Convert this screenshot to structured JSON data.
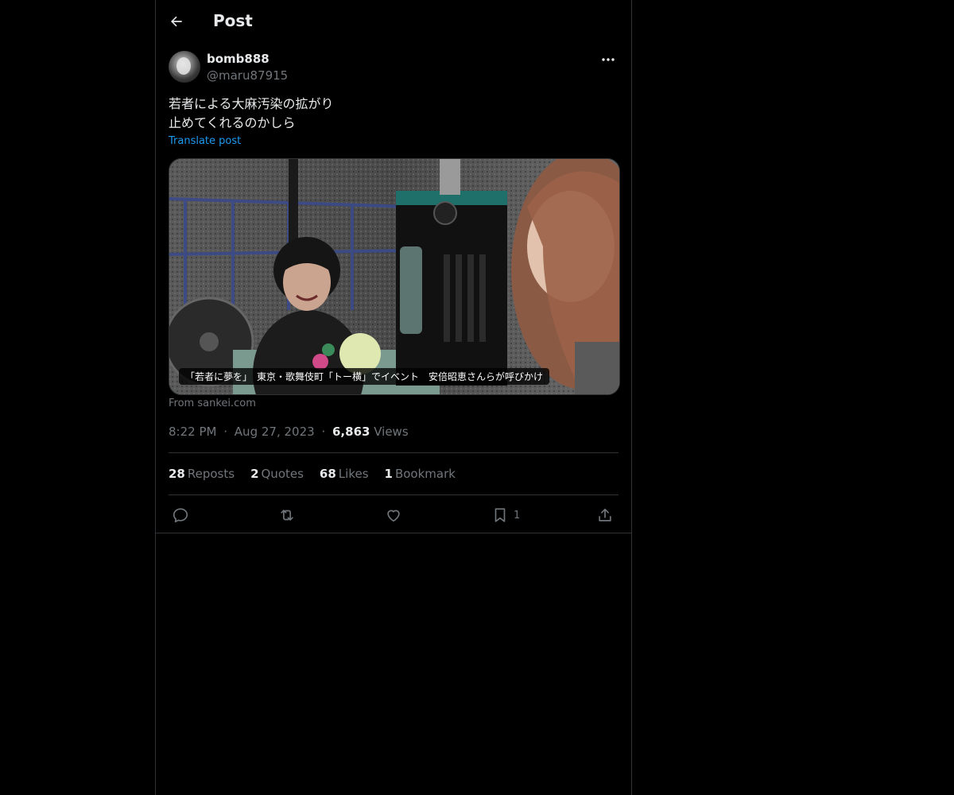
{
  "header": {
    "title": "Post",
    "back_icon": "arrow-left-icon"
  },
  "author": {
    "display_name": "bomb888",
    "handle": "@maru87915",
    "avatar_icon": "user-avatar"
  },
  "post": {
    "text_lines": [
      "若者による大麻汚染の拡がり",
      "止めてくれるのかしら"
    ],
    "translate_label": "Translate post"
  },
  "media": {
    "caption": "「若者に夢を」　東京・歌舞伎町「トー横」でイベント　安倍昭恵さんらが呼びかけ",
    "source": "From sankei.com"
  },
  "meta": {
    "time": "8:22 PM",
    "separator": "·",
    "date": "Aug 27, 2023",
    "views_count": "6,863",
    "views_label": "Views"
  },
  "stats": [
    {
      "count": "28",
      "label": "Reposts"
    },
    {
      "count": "2",
      "label": "Quotes"
    },
    {
      "count": "68",
      "label": "Likes"
    },
    {
      "count": "1",
      "label": "Bookmark"
    }
  ],
  "actions": {
    "bookmark_count": "1"
  },
  "colors": {
    "background": "#000000",
    "text": "#e7e9ea",
    "muted": "#71767b",
    "link": "#1d9bf0",
    "border": "#2f3336"
  }
}
